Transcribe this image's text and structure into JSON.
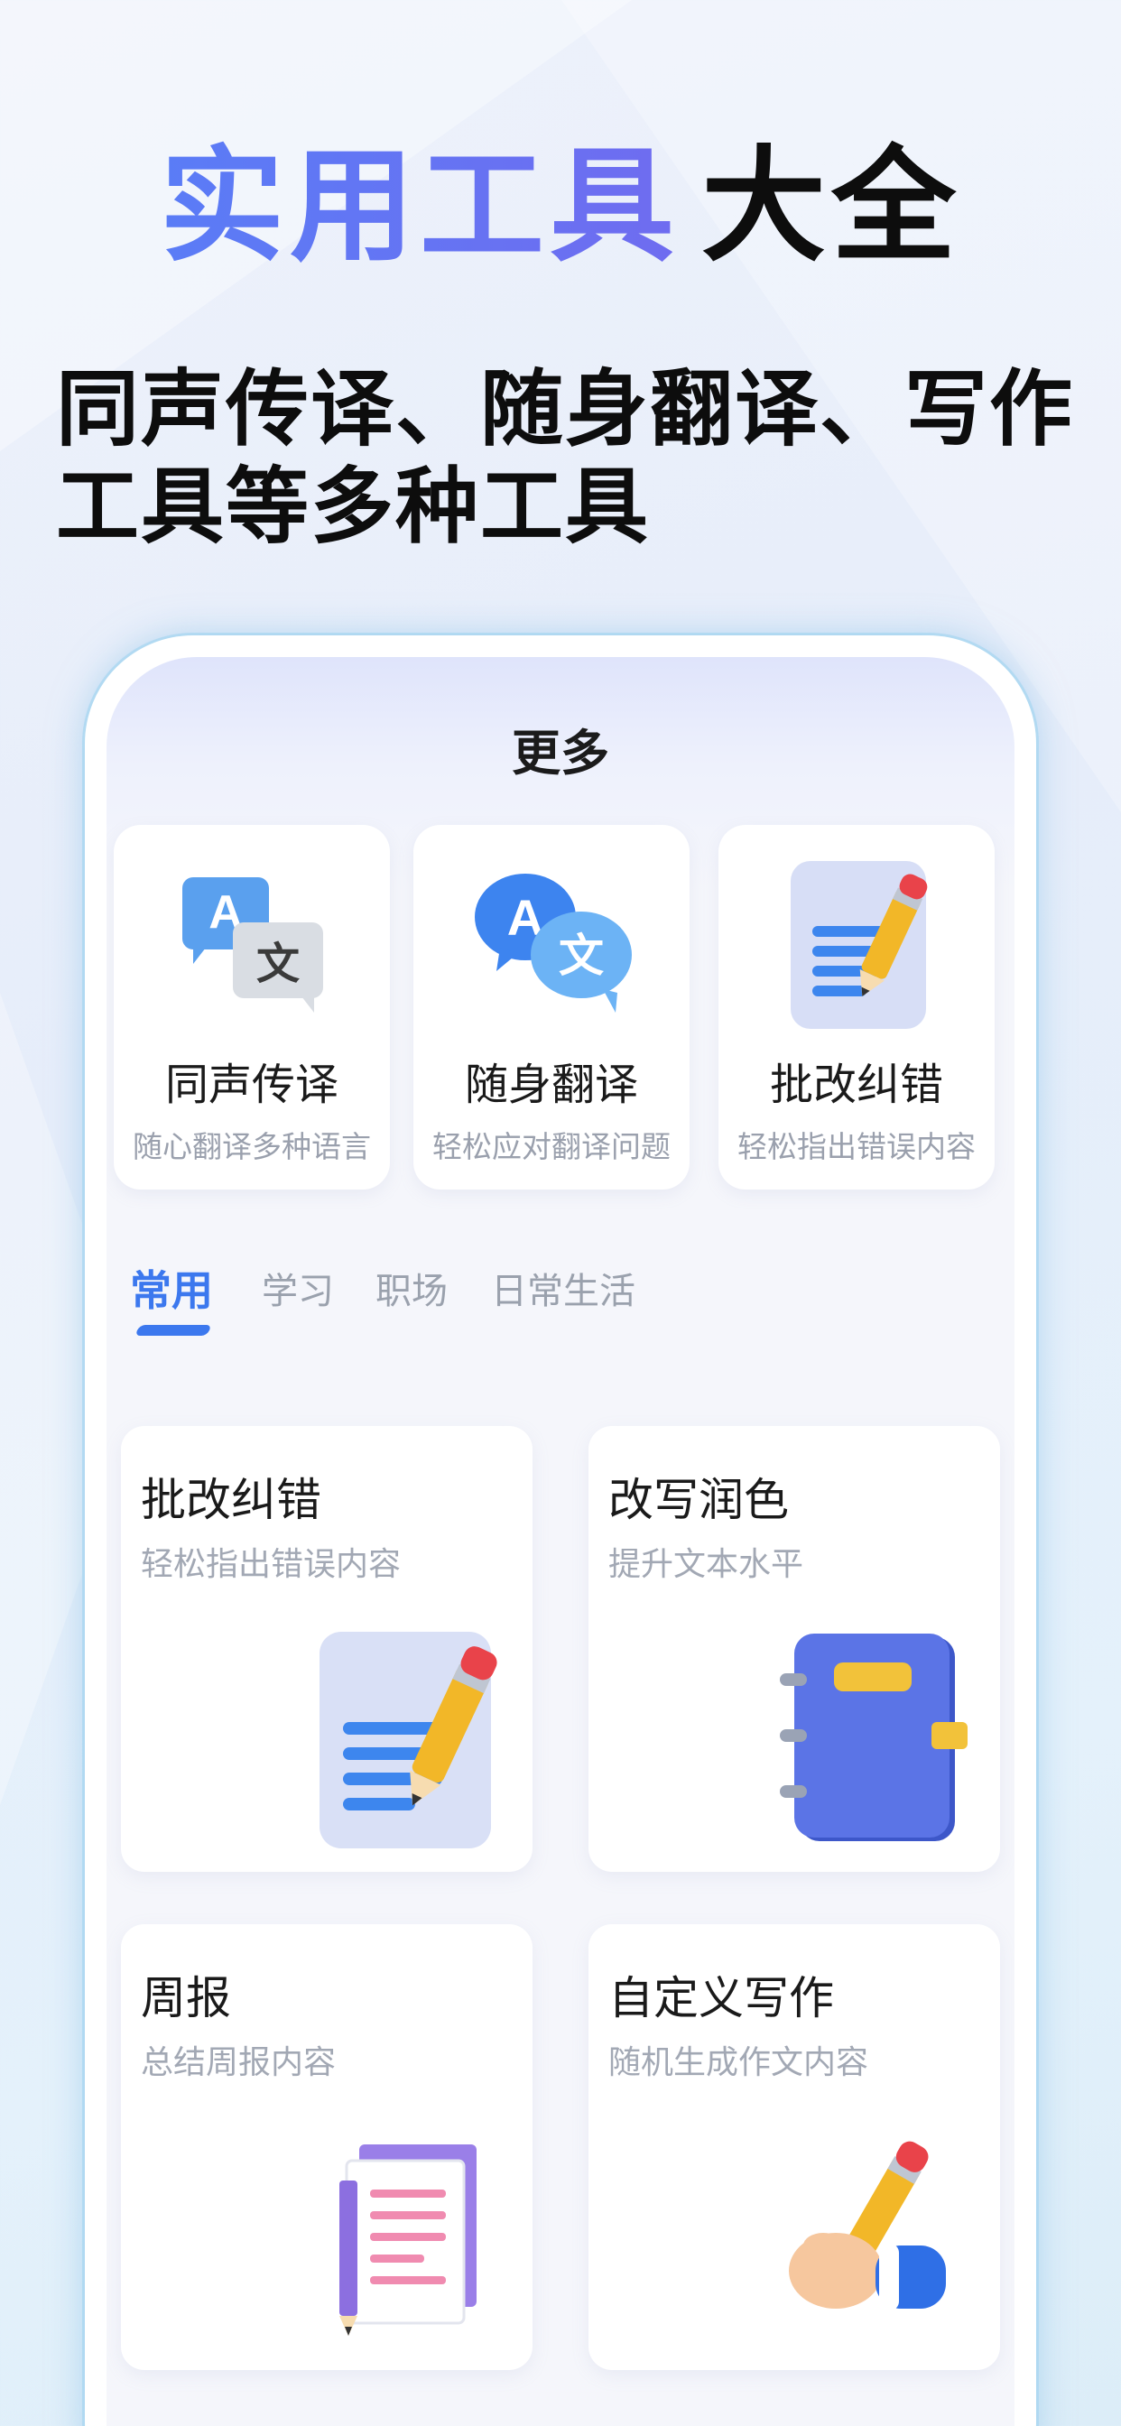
{
  "hero": {
    "title_accent": "实用工具",
    "title_plain": "大全",
    "subtitle": "同声传译、随身翻译、写作工具等多种工具"
  },
  "screen": {
    "title": "更多"
  },
  "features": [
    {
      "name": "同声传译",
      "desc": "随心翻译多种语言",
      "icon": "translate-bubbles-gray-icon"
    },
    {
      "name": "随身翻译",
      "desc": "轻松应对翻译问题",
      "icon": "translate-bubbles-blue-icon"
    },
    {
      "name": "批改纠错",
      "desc": "轻松指出错误内容",
      "icon": "document-pencil-icon"
    }
  ],
  "tabs": [
    {
      "label": "常用",
      "active": true
    },
    {
      "label": "学习",
      "active": false
    },
    {
      "label": "职场",
      "active": false
    },
    {
      "label": "日常生活",
      "active": false
    }
  ],
  "tools": [
    {
      "title": "批改纠错",
      "desc": "轻松指出错误内容",
      "icon": "document-pencil-icon"
    },
    {
      "title": "改写润色",
      "desc": "提升文本水平",
      "icon": "notebook-icon"
    },
    {
      "title": "周报",
      "desc": "总结周报内容",
      "icon": "report-pages-icon"
    },
    {
      "title": "自定义写作",
      "desc": "随机生成作文内容",
      "icon": "hand-pencil-icon"
    }
  ],
  "colors": {
    "accent": "#3c78ee",
    "title_gradient_start": "#5a7cf6",
    "title_gradient_end": "#6f6cf0",
    "pencil_yellow": "#f2b728",
    "notebook_blue": "#5b74e6"
  }
}
